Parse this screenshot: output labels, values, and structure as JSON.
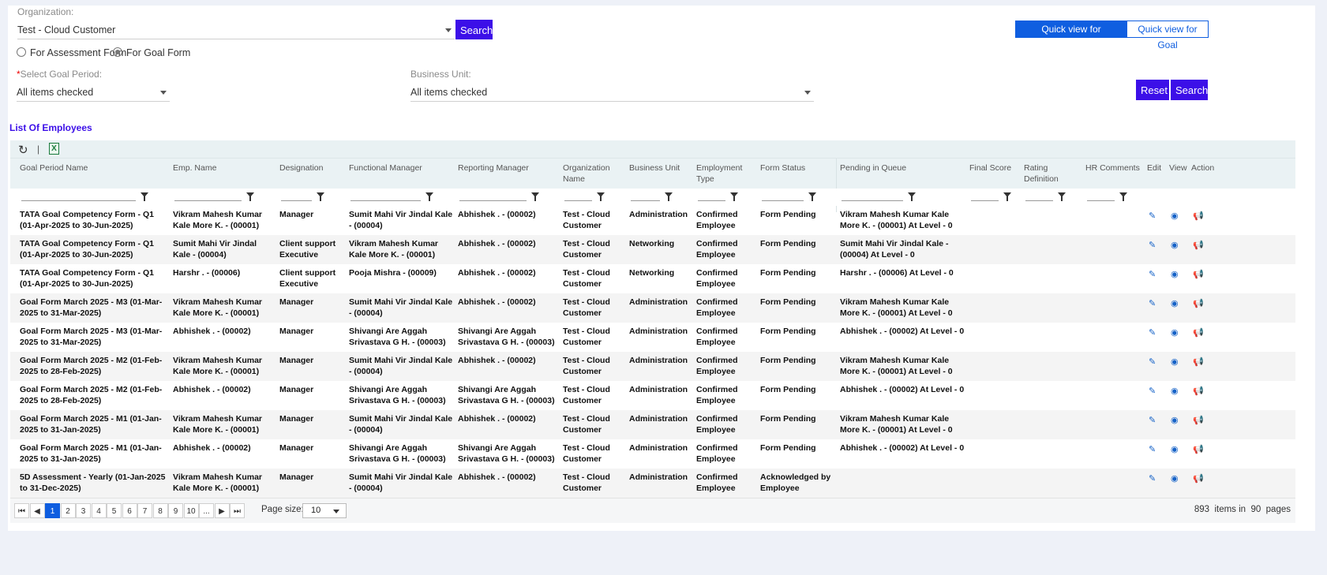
{
  "org": {
    "label": "Organization:",
    "value": "Test - Cloud Customer",
    "search_label": "Search"
  },
  "quick": {
    "assess_label": "Quick view for Assessments",
    "goal_label": "Quick view for Goal"
  },
  "radio": {
    "assess_label": "For Assessment Form",
    "goal_label": "For Goal Form",
    "selected": "goal"
  },
  "filters": {
    "goal_period": {
      "required_mark": "*",
      "label": "Select Goal Period:",
      "value": "All items checked"
    },
    "business_unit": {
      "label": "Business Unit:",
      "value": "All items checked"
    },
    "reset_label": "Reset",
    "search_label": "Search"
  },
  "list_title": "List Of Employees",
  "toolbar": {
    "refresh_icon": "refresh-icon",
    "separator": "|",
    "excel_icon": "excel-icon",
    "excel_glyph": "X"
  },
  "columns": [
    "Goal Period Name",
    "Emp. Name",
    "Designation",
    "Functional Manager",
    "Reporting Manager",
    "Organization Name",
    "Business Unit",
    "Employment Type",
    "Form Status",
    "Pending in Queue",
    "Final Score",
    "Rating Definition",
    "HR Comments",
    "Edit",
    "View",
    "Action"
  ],
  "rows": [
    [
      "TATA Goal Competency Form - Q1 (01-Apr-2025 to 30-Jun-2025)",
      "Vikram Mahesh Kumar Kale More K. - (00001)",
      "Manager",
      "Sumit Mahi Vir Jindal Kale - (00004)",
      "Abhishek . - (00002)",
      "Test - Cloud Customer",
      "Administration",
      "Confirmed Employee",
      "Form Pending",
      "Vikram Mahesh Kumar Kale More K. - (00001) At Level - 0"
    ],
    [
      "TATA Goal Competency Form - Q1 (01-Apr-2025 to 30-Jun-2025)",
      "Sumit Mahi Vir Jindal Kale - (00004)",
      "Client support Executive",
      "Vikram Mahesh Kumar Kale More K. - (00001)",
      "Abhishek . - (00002)",
      "Test - Cloud Customer",
      "Networking",
      "Confirmed Employee",
      "Form Pending",
      "Sumit Mahi Vir Jindal Kale - (00004) At Level - 0"
    ],
    [
      "TATA Goal Competency Form - Q1 (01-Apr-2025 to 30-Jun-2025)",
      "Harshr . - (00006)",
      "Client support Executive",
      "Pooja Mishra - (00009)",
      "Abhishek . - (00002)",
      "Test - Cloud Customer",
      "Networking",
      "Confirmed Employee",
      "Form Pending",
      "Harshr . - (00006) At Level - 0"
    ],
    [
      "Goal Form March 2025 - M3 (01-Mar-2025 to 31-Mar-2025)",
      "Vikram Mahesh Kumar Kale More K. - (00001)",
      "Manager",
      "Sumit Mahi Vir Jindal Kale - (00004)",
      "Abhishek . - (00002)",
      "Test - Cloud Customer",
      "Administration",
      "Confirmed Employee",
      "Form Pending",
      "Vikram Mahesh Kumar Kale More K. - (00001) At Level - 0"
    ],
    [
      "Goal Form March 2025 - M3 (01-Mar-2025 to 31-Mar-2025)",
      "Abhishek . - (00002)",
      "Manager",
      "Shivangi Are Aggah Srivastava G H. - (00003)",
      "Shivangi Are Aggah Srivastava G H. - (00003)",
      "Test - Cloud Customer",
      "Administration",
      "Confirmed Employee",
      "Form Pending",
      "Abhishek . - (00002) At Level - 0"
    ],
    [
      "Goal Form March 2025 - M2 (01-Feb-2025 to 28-Feb-2025)",
      "Vikram Mahesh Kumar Kale More K. - (00001)",
      "Manager",
      "Sumit Mahi Vir Jindal Kale - (00004)",
      "Abhishek . - (00002)",
      "Test - Cloud Customer",
      "Administration",
      "Confirmed Employee",
      "Form Pending",
      "Vikram Mahesh Kumar Kale More K. - (00001) At Level - 0"
    ],
    [
      "Goal Form March 2025 - M2 (01-Feb-2025 to 28-Feb-2025)",
      "Abhishek . - (00002)",
      "Manager",
      "Shivangi Are Aggah Srivastava G H. - (00003)",
      "Shivangi Are Aggah Srivastava G H. - (00003)",
      "Test - Cloud Customer",
      "Administration",
      "Confirmed Employee",
      "Form Pending",
      "Abhishek . - (00002) At Level - 0"
    ],
    [
      "Goal Form March 2025 - M1 (01-Jan-2025 to 31-Jan-2025)",
      "Vikram Mahesh Kumar Kale More K. - (00001)",
      "Manager",
      "Sumit Mahi Vir Jindal Kale - (00004)",
      "Abhishek . - (00002)",
      "Test - Cloud Customer",
      "Administration",
      "Confirmed Employee",
      "Form Pending",
      "Vikram Mahesh Kumar Kale More K. - (00001) At Level - 0"
    ],
    [
      "Goal Form March 2025 - M1 (01-Jan-2025 to 31-Jan-2025)",
      "Abhishek . - (00002)",
      "Manager",
      "Shivangi Are Aggah Srivastava G H. - (00003)",
      "Shivangi Are Aggah Srivastava G H. - (00003)",
      "Test - Cloud Customer",
      "Administration",
      "Confirmed Employee",
      "Form Pending",
      "Abhishek . - (00002) At Level - 0"
    ],
    [
      "5D Assessment - Yearly (01-Jan-2025 to 31-Dec-2025)",
      "Vikram Mahesh Kumar Kale More K. - (00001)",
      "Manager",
      "Sumit Mahi Vir Jindal Kale - (00004)",
      "Abhishek . - (00002)",
      "Test - Cloud Customer",
      "Administration",
      "Confirmed Employee",
      "Acknowledged by Employee",
      ""
    ]
  ],
  "row_icons": {
    "edit": "edit-icon",
    "view": "eye-icon",
    "action": "megaphone-icon",
    "edit_glyph": "✎",
    "view_glyph": "◉",
    "action_glyph": "📢"
  },
  "pager": {
    "first": "⏮",
    "prev": "◀",
    "pages": [
      "1",
      "2",
      "3",
      "4",
      "5",
      "6",
      "7",
      "8",
      "9",
      "10",
      "..."
    ],
    "current": "1",
    "next": "▶",
    "last": "⏭",
    "page_size_label": "Page size:",
    "page_size": "10",
    "total_items": "893",
    "items_in": "items in",
    "total_pages": "90",
    "pages_label": "pages"
  },
  "colors": {
    "accent": "#3c0fe8",
    "blue": "#0f5ee0",
    "icon_blue": "#1461c7"
  }
}
